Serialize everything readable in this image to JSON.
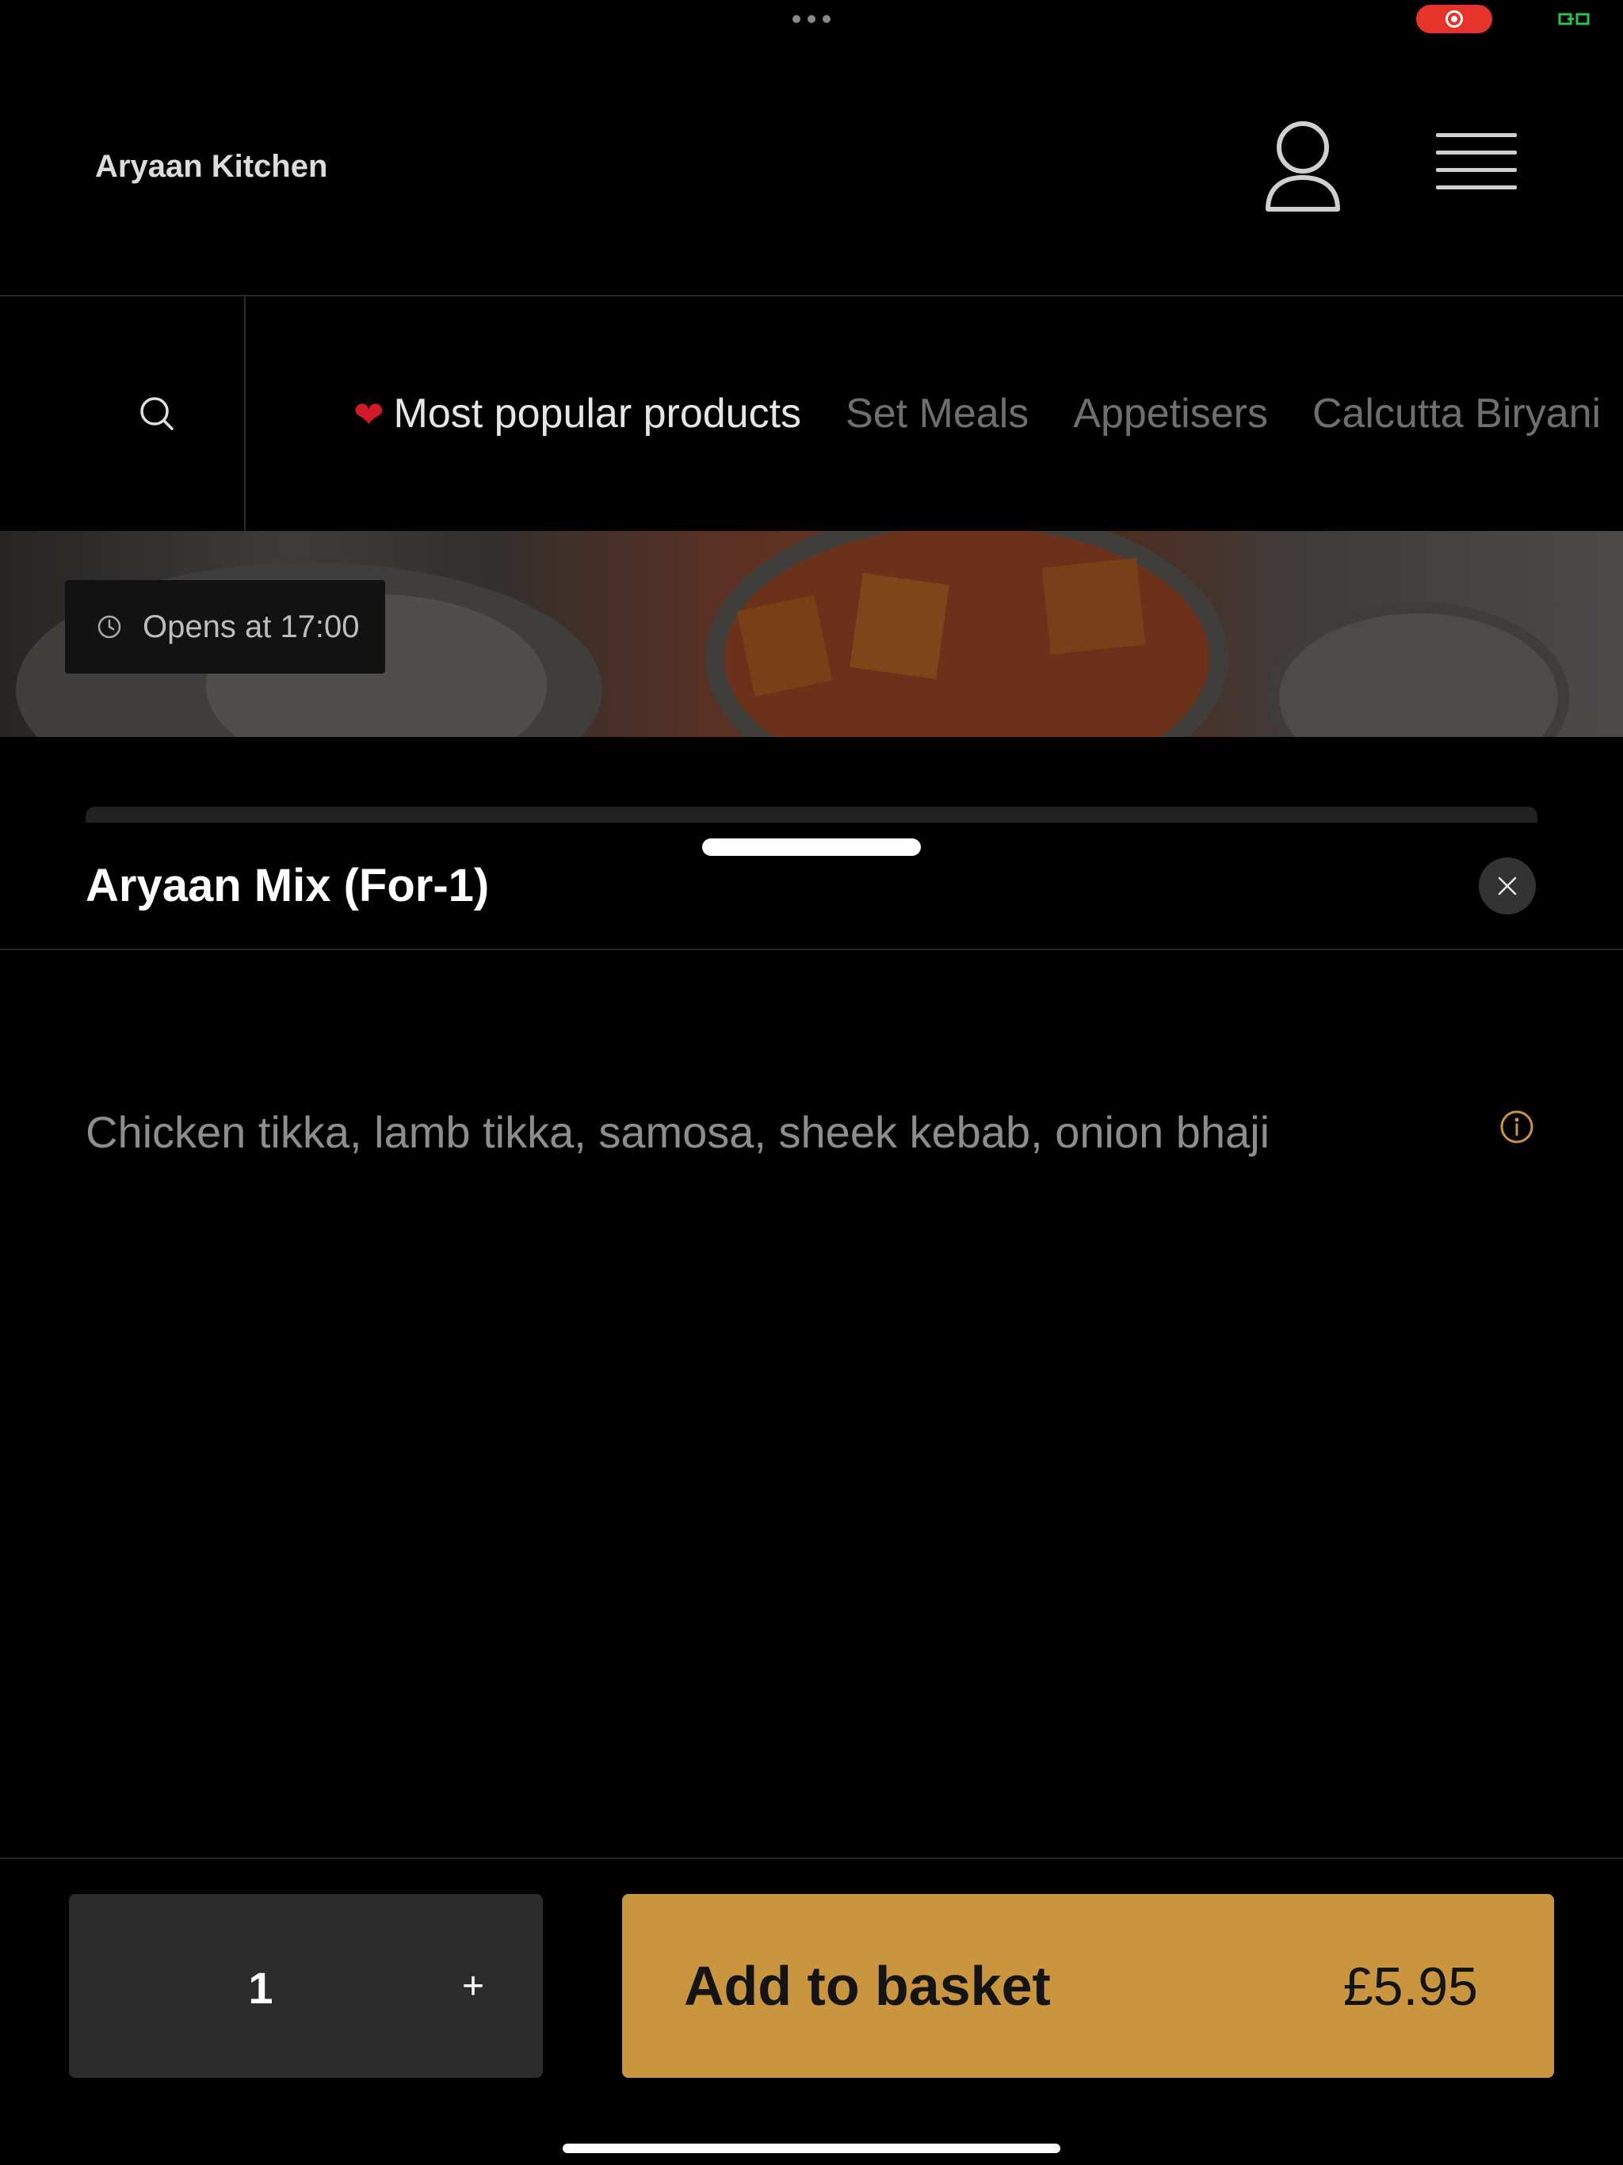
{
  "header": {
    "brand": "Aryaan Kitchen"
  },
  "nav": {
    "categories": [
      {
        "label": "Most popular products",
        "icon": "heart-icon",
        "active": true
      },
      {
        "label": "Set Meals",
        "active": false
      },
      {
        "label": "Appetisers",
        "active": false
      },
      {
        "label": "Calcutta Biryani",
        "active": false
      }
    ]
  },
  "hero": {
    "opens_label": "Opens at 17:00"
  },
  "product": {
    "title": "Aryaan Mix (For-1)",
    "description": "Chicken tikka, lamb tikka, samosa, sheek kebab, onion bhaji",
    "quantity": "1",
    "plus_label": "+",
    "add_label": "Add to basket",
    "price": "£5.95"
  },
  "colors": {
    "accent": "#c9953f",
    "background": "#000000",
    "record": "#e5332a"
  }
}
